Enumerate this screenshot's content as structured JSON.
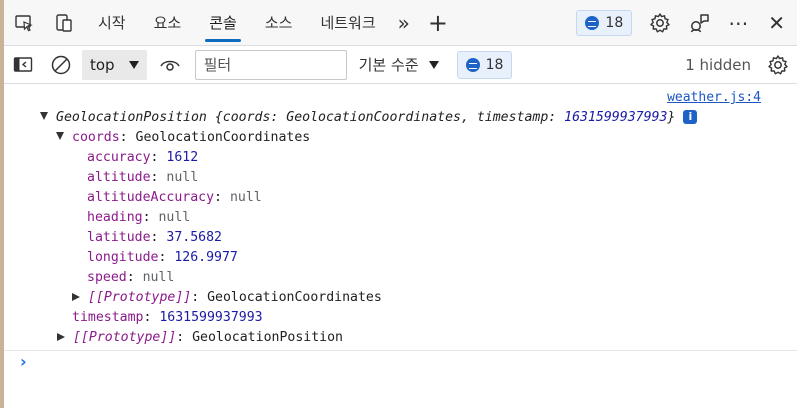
{
  "tabbar": {
    "tabs": [
      {
        "label": "시작",
        "active": false
      },
      {
        "label": "요소",
        "active": false
      },
      {
        "label": "콘솔",
        "active": true
      },
      {
        "label": "소스",
        "active": false
      },
      {
        "label": "네트워크",
        "active": false
      }
    ],
    "overflow_label": "»",
    "add_label": "+",
    "issues_count": "18",
    "more_label": "⋯",
    "close_label": "✕"
  },
  "toolbar": {
    "context": "top",
    "filter_placeholder": "필터",
    "level_label": "기본 수준",
    "issues_count": "18",
    "hidden_label": "1 hidden"
  },
  "console": {
    "source_link": "weather.js:4",
    "summary": {
      "type": "GeolocationPosition",
      "preview_prefix": "{coords: ",
      "preview_coords": "GeolocationCoordinates",
      "preview_mid": ", timestamp: ",
      "preview_timestamp": "1631599937993",
      "preview_suffix": "}",
      "info": "i"
    },
    "coords": {
      "key": "coords",
      "type": "GeolocationCoordinates",
      "props": [
        {
          "key": "accuracy",
          "value": "1612",
          "kind": "num"
        },
        {
          "key": "altitude",
          "value": "null",
          "kind": "nul"
        },
        {
          "key": "altitudeAccuracy",
          "value": "null",
          "kind": "nul"
        },
        {
          "key": "heading",
          "value": "null",
          "kind": "nul"
        },
        {
          "key": "latitude",
          "value": "37.5682",
          "kind": "num"
        },
        {
          "key": "longitude",
          "value": "126.9977",
          "kind": "num"
        },
        {
          "key": "speed",
          "value": "null",
          "kind": "nul"
        }
      ],
      "proto_key": "[[Prototype]]",
      "proto_value": "GeolocationCoordinates"
    },
    "timestamp": {
      "key": "timestamp",
      "value": "1631599937993"
    },
    "proto": {
      "key": "[[Prototype]]",
      "value": "GeolocationPosition"
    },
    "prompt": "›"
  }
}
